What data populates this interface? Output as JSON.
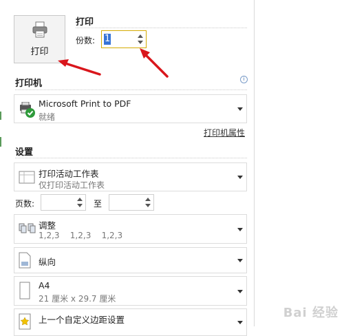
{
  "print_section": {
    "print_button_label": "打印",
    "title": "打印",
    "copies_label": "份数:",
    "copies_value": "1"
  },
  "printer_section": {
    "title": "打印机",
    "info_icon": "i",
    "printer_name": "Microsoft Print to PDF",
    "printer_status": "就绪",
    "properties_link": "打印机属性"
  },
  "settings_section": {
    "title": "设置",
    "print_what": {
      "main": "打印活动工作表",
      "sub": "仅打印活动工作表"
    },
    "pages": {
      "label": "页数:",
      "to_label": "至",
      "from_value": "",
      "to_value": ""
    },
    "collation": {
      "main": "调整",
      "sub": "1,2,3    1,2,3    1,2,3"
    },
    "orientation": {
      "main": "纵向"
    },
    "paper_size": {
      "main": "A4",
      "sub": "21 厘米 x 29.7 厘米"
    },
    "margins": {
      "main": "上一个自定义边距设置"
    }
  },
  "watermark": "Bai 经验",
  "colors": {
    "accent_highlight": "#3875d7",
    "focus_border": "#d4aa00",
    "arrow_red": "#d9161c",
    "ready_green": "#2e9a3a"
  }
}
